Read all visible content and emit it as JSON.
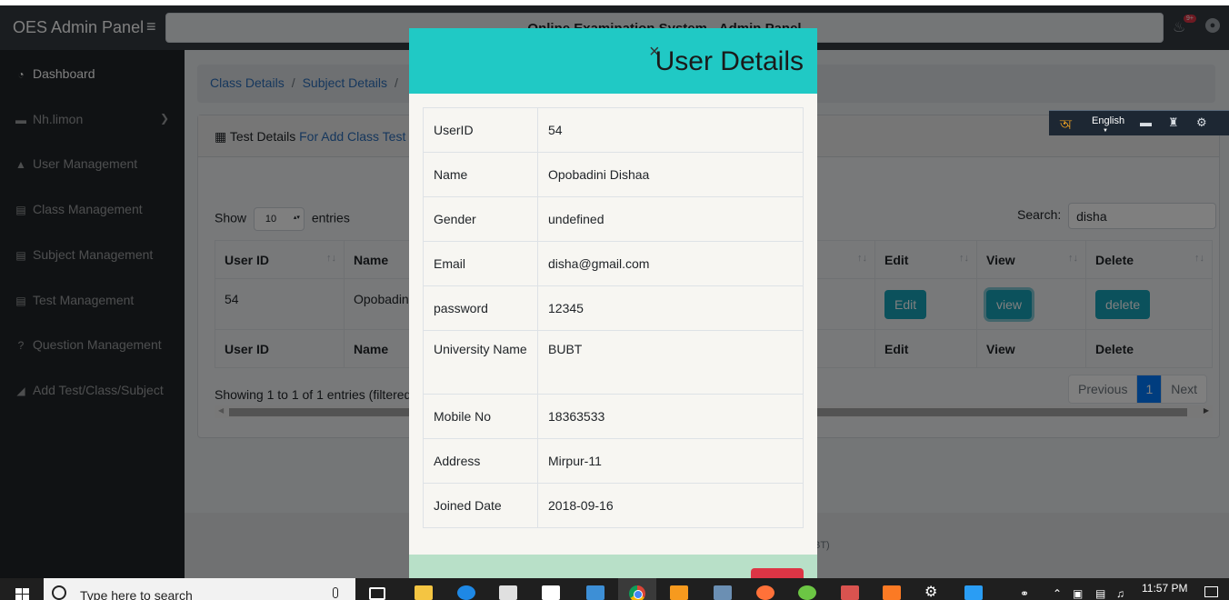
{
  "navbar": {
    "brand": "OES Admin Panel",
    "toggle_icon": "≡",
    "center_title": "Online Examination System - Admin Panel",
    "notification_badge": "9+"
  },
  "sidebar": {
    "items": [
      {
        "label": "Dashboard",
        "icon": "dashboard-icon",
        "glyph": "◔"
      },
      {
        "label": "Nh.limon",
        "icon": "folder-icon",
        "glyph": "▬"
      },
      {
        "label": "User Management",
        "icon": "user-icon",
        "glyph": "▲"
      },
      {
        "label": "Class Management",
        "icon": "book-icon",
        "glyph": "▤"
      },
      {
        "label": "Subject Management",
        "icon": "book-icon",
        "glyph": "▤"
      },
      {
        "label": "Test Management",
        "icon": "book-icon",
        "glyph": "▤"
      },
      {
        "label": "Question Management",
        "icon": "question-icon",
        "glyph": "?"
      },
      {
        "label": "Add Test/Class/Subject",
        "icon": "area-chart-icon",
        "glyph": "◢"
      }
    ]
  },
  "breadcrumb": {
    "items": [
      "Class Details",
      "Subject Details"
    ],
    "separator": "/"
  },
  "card": {
    "title_prefix": "Test Details",
    "title_link": "For Add Class Test"
  },
  "datatable": {
    "show_label": "Show",
    "entries_value": "10",
    "entries_label": "entries",
    "search_label": "Search:",
    "search_value": "disha",
    "columns": [
      "User ID",
      "Name",
      "Edit",
      "View",
      "Delete"
    ],
    "row": {
      "user_id": "54",
      "name": "Opobadini Dishaa",
      "edit": "Edit",
      "view": "view",
      "delete": "delete"
    },
    "info": "Showing 1 to 1 of 1 entries (filtered",
    "pager": {
      "previous": "Previous",
      "current": "1",
      "next": "Next"
    }
  },
  "footer": {
    "text": "BT)"
  },
  "modal": {
    "close": "×",
    "title": "User Details",
    "fields": [
      {
        "key": "UserID",
        "value": "54"
      },
      {
        "key": "Name",
        "value": "Opobadini Dishaa"
      },
      {
        "key": "Gender",
        "value": "undefined"
      },
      {
        "key": "Email",
        "value": "disha@gmail.com"
      },
      {
        "key": "password",
        "value": "12345"
      },
      {
        "key": "University Name",
        "value": "BUBT"
      },
      {
        "key": "Mobile No",
        "value": "18363533"
      },
      {
        "key": "Address",
        "value": "Mirpur-11"
      },
      {
        "key": "Joined Date",
        "value": "2018-09-16"
      }
    ]
  },
  "language_bar": {
    "bangla": "অ",
    "language": "English"
  },
  "taskbar": {
    "search_placeholder": "Type here to search",
    "time": "11:57 PM"
  },
  "colors": {
    "modal_header": "#20c9c5",
    "teal_button": "#17a2b8",
    "pager_active": "#007bff"
  }
}
